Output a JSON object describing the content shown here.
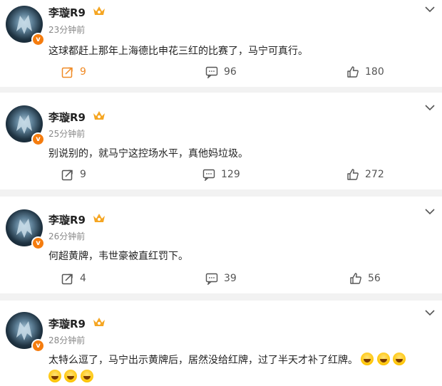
{
  "posts": [
    {
      "username": "李璇R9",
      "time": "23分钟前",
      "text": "这球都赶上那年上海德比申花三红的比赛了，马宁可真行。",
      "share_count": "9",
      "comment_count": "96",
      "like_count": "180",
      "share_active": true
    },
    {
      "username": "李璇R9",
      "time": "25分钟前",
      "text": "别说别的，就马宁这控场水平，真他妈垃圾。",
      "share_count": "9",
      "comment_count": "129",
      "like_count": "272",
      "share_active": false
    },
    {
      "username": "李璇R9",
      "time": "26分钟前",
      "text": "何超黄牌，韦世豪被直红罚下。",
      "share_count": "4",
      "comment_count": "39",
      "like_count": "56",
      "share_active": false
    },
    {
      "username": "李璇R9",
      "time": "28分钟前",
      "text_line1": "太特么逗了，马宁出示黄牌后，居然没给红牌，过了半天才补了红牌。",
      "emojis": [
        "laugh-cry",
        "laugh-cry",
        "laugh-cry",
        "laugh-cry",
        "laugh-cry",
        "laugh-cry"
      ]
    }
  ],
  "colors": {
    "accent": "#f08a24",
    "vip_badge": "#f57c0e",
    "separator": "#f2f2f2"
  }
}
